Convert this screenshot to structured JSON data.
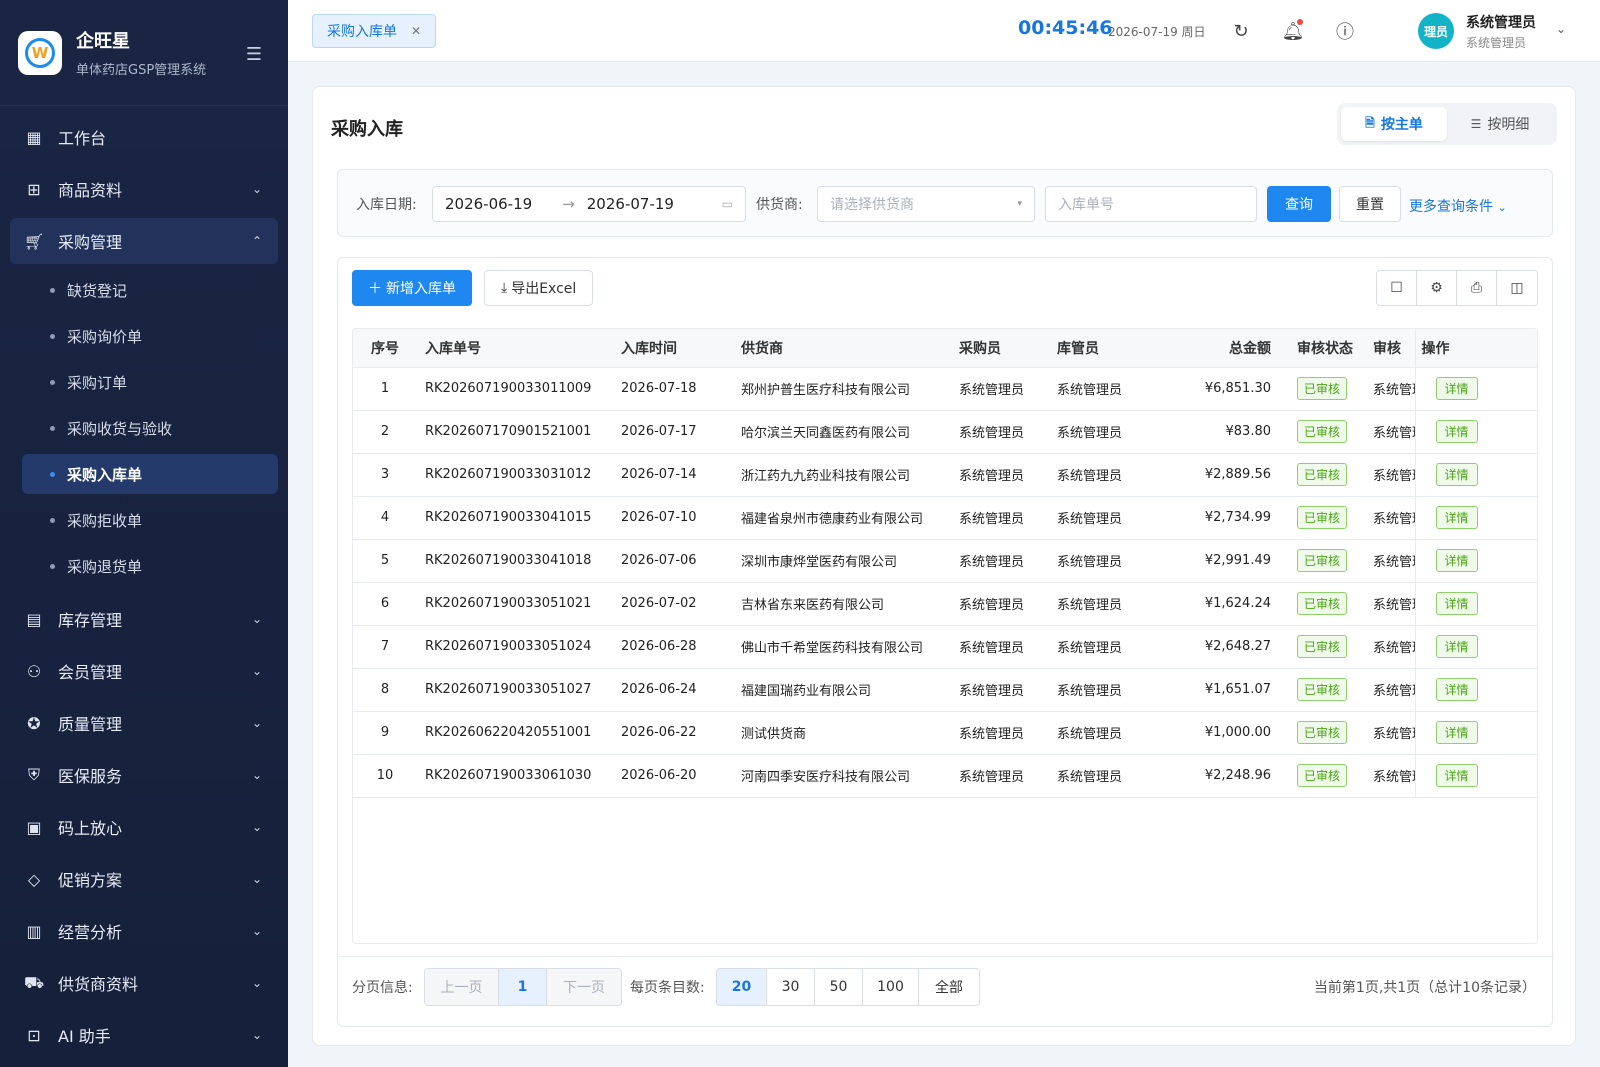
{
  "brand": {
    "name": "企旺星",
    "subtitle": "单体药店GSP管理系统"
  },
  "sidebar": {
    "items": [
      {
        "label": "工作台",
        "icon": "dashboard-icon"
      },
      {
        "label": "商品资料",
        "icon": "goods-icon"
      },
      {
        "label": "采购管理",
        "icon": "cart-icon"
      },
      {
        "label": "库存管理",
        "icon": "inventory-icon"
      },
      {
        "label": "会员管理",
        "icon": "members-icon"
      },
      {
        "label": "质量管理",
        "icon": "quality-icon"
      },
      {
        "label": "医保服务",
        "icon": "insurance-icon"
      },
      {
        "label": "码上放心",
        "icon": "qrcode-icon"
      },
      {
        "label": "促销方案",
        "icon": "tag-icon"
      },
      {
        "label": "经营分析",
        "icon": "analysis-icon"
      },
      {
        "label": "供货商资料",
        "icon": "truck-icon"
      },
      {
        "label": "AI 助手",
        "icon": "robot-icon"
      }
    ],
    "purchase_sub": [
      "缺货登记",
      "采购询价单",
      "采购订单",
      "采购收货与验收",
      "采购入库单",
      "采购拒收单",
      "采购退货单"
    ]
  },
  "topbar": {
    "tab_label": "采购入库单",
    "clock": "00:45:46",
    "date": "2026-07-19 周日",
    "avatar_text": "理员",
    "user_name": "系统管理员",
    "user_role": "系统管理员"
  },
  "page": {
    "title": "采购入库",
    "view_master": "按主单",
    "view_detail": "按明细"
  },
  "filter": {
    "date_label": "入库日期:",
    "date_start": "2026-06-19",
    "date_sep": "→",
    "date_end": "2026-07-19",
    "supplier_label": "供货商:",
    "supplier_placeholder": "请选择供货商",
    "order_placeholder": "入库单号",
    "query": "查询",
    "reset": "重置",
    "more": "更多查询条件"
  },
  "toolbar": {
    "add": "新增入库单",
    "export": "导出Excel"
  },
  "table": {
    "headers": [
      "序号",
      "入库单号",
      "入库时间",
      "供货商",
      "采购员",
      "库管员",
      "总金额",
      "审核状态",
      "审核",
      "操作"
    ],
    "status_text": "已审核",
    "detail_text": "详情",
    "rows": [
      [
        "1",
        "RK202607190033011009",
        "2026-07-18",
        "郑州护普生医疗科技有限公司",
        "系统管理员",
        "系统管理员",
        "¥6,851.30",
        "系统管理员"
      ],
      [
        "2",
        "RK202607170901521001",
        "2026-07-17",
        "哈尔滨兰天同鑫医药有限公司",
        "系统管理员",
        "系统管理员",
        "¥83.80",
        "系统管理员"
      ],
      [
        "3",
        "RK202607190033031012",
        "2026-07-14",
        "浙江药九九药业科技有限公司",
        "系统管理员",
        "系统管理员",
        "¥2,889.56",
        "系统管理员"
      ],
      [
        "4",
        "RK202607190033041015",
        "2026-07-10",
        "福建省泉州市德康药业有限公司",
        "系统管理员",
        "系统管理员",
        "¥2,734.99",
        "系统管理员"
      ],
      [
        "5",
        "RK202607190033041018",
        "2026-07-06",
        "深圳市康烨堂医药有限公司",
        "系统管理员",
        "系统管理员",
        "¥2,991.49",
        "系统管理员"
      ],
      [
        "6",
        "RK202607190033051021",
        "2026-07-02",
        "吉林省东来医药有限公司",
        "系统管理员",
        "系统管理员",
        "¥1,624.24",
        "系统管理员"
      ],
      [
        "7",
        "RK202607190033051024",
        "2026-06-28",
        "佛山市千希堂医药科技有限公司",
        "系统管理员",
        "系统管理员",
        "¥2,648.27",
        "系统管理员"
      ],
      [
        "8",
        "RK202607190033051027",
        "2026-06-24",
        "福建国瑞药业有限公司",
        "系统管理员",
        "系统管理员",
        "¥1,651.07",
        "系统管理员"
      ],
      [
        "9",
        "RK202606220420551001",
        "2026-06-22",
        "测试供货商",
        "系统管理员",
        "系统管理员",
        "¥1,000.00",
        "系统管理员"
      ],
      [
        "10",
        "RK202607190033061030",
        "2026-06-20",
        "河南四季安医疗科技有限公司",
        "系统管理员",
        "系统管理员",
        "¥2,248.96",
        "系统管理员"
      ]
    ]
  },
  "pager": {
    "label": "分页信息:",
    "prev": "上一页",
    "current": "1",
    "next": "下一页",
    "size_label": "每页条目数:",
    "sizes": [
      "20",
      "30",
      "50",
      "100",
      "全部"
    ],
    "info": "当前第1页,共1页（总计10条记录）"
  },
  "colors": {
    "primary": "#1e88f0",
    "sidebar": "#1a2544",
    "success": "#4aa615"
  }
}
